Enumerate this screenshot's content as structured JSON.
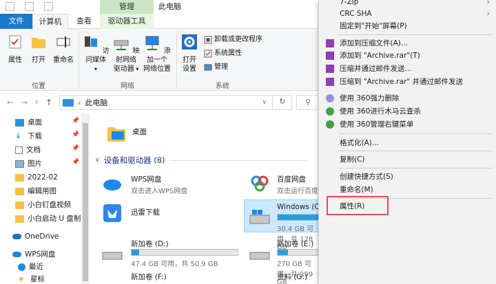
{
  "titlebar": {
    "context_tab_header": "管理",
    "window_title": "此电脑"
  },
  "tabs": {
    "file": "文件",
    "computer": "计算机",
    "view": "查看",
    "drive_tools": "驱动器工具"
  },
  "ribbon": {
    "properties": "属性",
    "open": "打开",
    "rename": "重命名",
    "location_group": "位置",
    "access_media": "访问媒体",
    "map_drive_line1": "映射网络",
    "map_drive_line2": "驱动器",
    "add_location_line1": "添加一个",
    "add_location_line2": "网络位置",
    "network_group": "网络",
    "open_settings_line1": "打开",
    "open_settings_line2": "设置",
    "uninstall": "卸载或更改程序",
    "system_properties": "系统属性",
    "manage": "管理",
    "system_group": "系统"
  },
  "address": {
    "path": "此电脑",
    "refresh": "↻"
  },
  "nav": {
    "items": [
      {
        "label": "桌面",
        "pinned": true
      },
      {
        "label": "下载",
        "pinned": true
      },
      {
        "label": "文档",
        "pinned": true
      },
      {
        "label": "图片",
        "pinned": true
      },
      {
        "label": "2022-02",
        "pinned": false
      },
      {
        "label": "编辑用图",
        "pinned": false
      },
      {
        "label": "小白钉盘视频",
        "pinned": false
      },
      {
        "label": "小白启动 U 盘制",
        "pinned": false
      }
    ],
    "onedrive": "OneDrive",
    "wps": "WPS网盘",
    "recent": "最近",
    "starred": "星标"
  },
  "main": {
    "desktop_folder": "桌面",
    "section_title": "设备和驱动器 (8)",
    "drives": [
      {
        "name": "WPS网盘",
        "sub": "双击进入WPS网盘"
      },
      {
        "name": "百度网盘",
        "sub": "双击运行百度"
      },
      {
        "name": "迅雷下载",
        "sub": ""
      },
      {
        "name": "Windows (C:",
        "sub": "30.4 GB 可用，共 178 GB",
        "fill_percent": 83
      },
      {
        "name": "新加卷 (D:)",
        "sub": "47.4 GB 可用，共 50.9 GB",
        "fill_percent": 7
      },
      {
        "name": "新加卷 (E:)",
        "sub": "270 GB 可用，共 299 GB",
        "fill_percent": 10
      },
      {
        "name": "新加卷 (F:)",
        "sub": ""
      },
      {
        "name": "资料 (G:)",
        "sub": ""
      }
    ]
  },
  "context_menu": {
    "items": [
      {
        "label": "7-Zip",
        "submenu": true
      },
      {
        "label": "CRC SHA",
        "submenu": true
      },
      {
        "label": "固定到\"开始\"屏幕(P)"
      },
      {
        "label": "添加到压缩文件(A)..."
      },
      {
        "label": "添加到 \"Archive.rar\"(T)"
      },
      {
        "label": "压缩并通过邮件发送..."
      },
      {
        "label": "压缩到 \"Archive.rar\" 并通过邮件发送"
      },
      {
        "label": "使用 360强力删除"
      },
      {
        "label": "使用 360进行木马云查杀"
      },
      {
        "label": "使用 360管理右键菜单"
      },
      {
        "label": "格式化(A)..."
      },
      {
        "label": "复制(C)"
      },
      {
        "label": "创建快捷方式(S)"
      },
      {
        "label": "重命名(M)"
      },
      {
        "label": "属性(R)"
      }
    ]
  },
  "colors": {
    "accent": "#1979ca",
    "context_tab": "#c8e6c0",
    "selection": "#cce8ff",
    "highlight_border": "#e14c4c",
    "capacity_fill": "#26a0da"
  }
}
